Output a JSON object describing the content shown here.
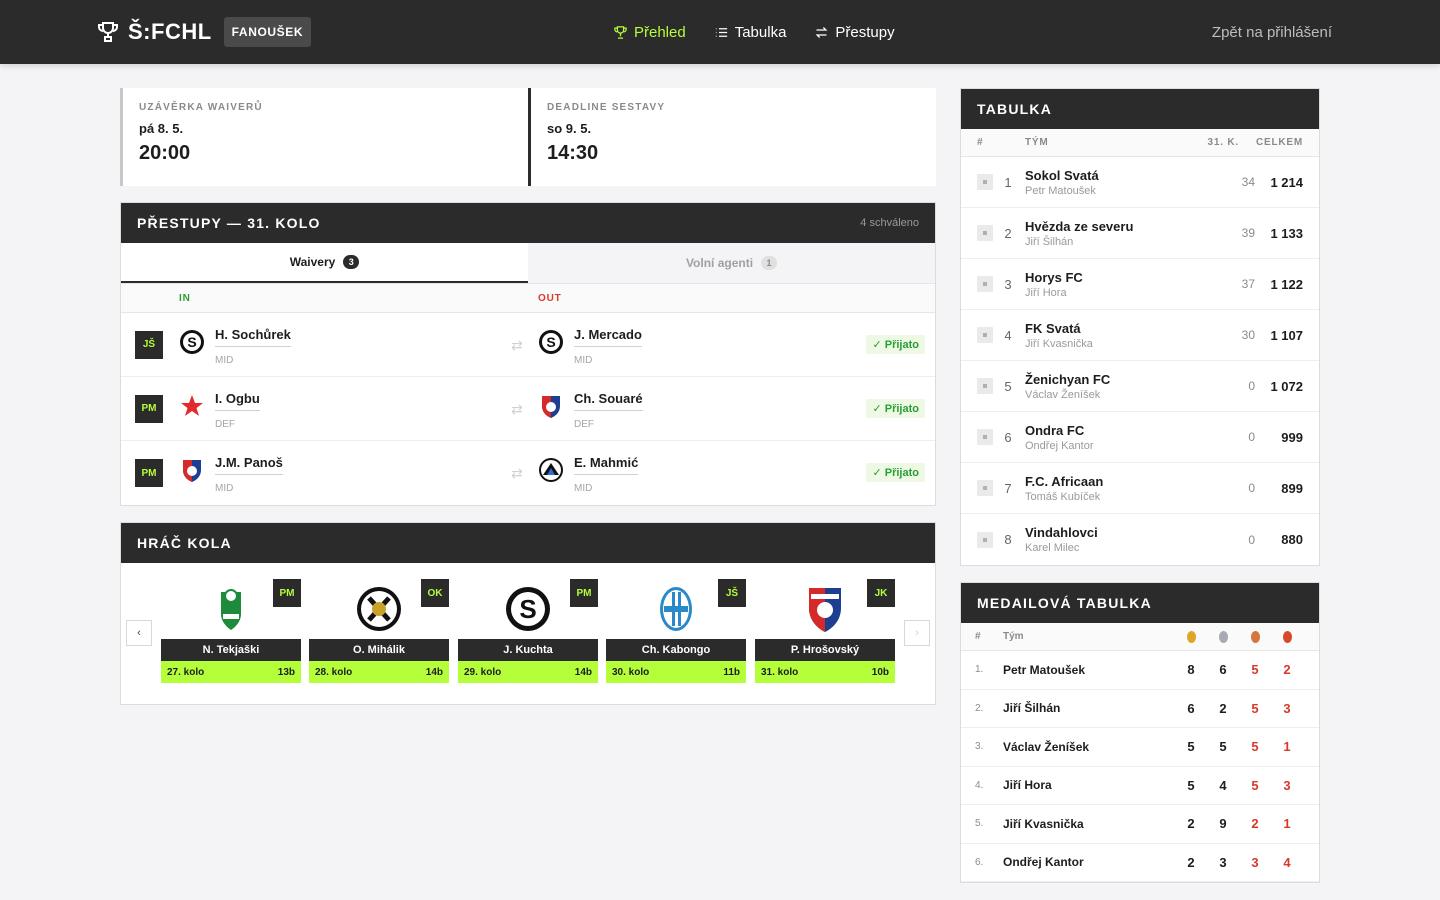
{
  "nav": {
    "brand": "Š:FCHL",
    "role": "FANOUŠEK",
    "items": [
      {
        "label": "Přehled",
        "icon": "trophy-icon",
        "active": true
      },
      {
        "label": "Tabulka",
        "icon": "list-icon",
        "active": false
      },
      {
        "label": "Přestupy",
        "icon": "swap-icon",
        "active": false
      }
    ],
    "logout": "Zpět na přihlášení"
  },
  "deadlines": [
    {
      "label": "UZÁVĚRKA WAIVERŮ",
      "date": "pá 8. 5.",
      "time": "20:00"
    },
    {
      "label": "DEADLINE SESTAVY",
      "date": "so 9. 5.",
      "time": "14:30"
    }
  ],
  "transfers": {
    "title": "PŘESTUPY — 31. KOLO",
    "approved": "4 schváleno",
    "tabs": [
      {
        "label": "Waivery",
        "count": "3"
      },
      {
        "label": "Volní agenti",
        "count": "1"
      }
    ],
    "in_label": "IN",
    "out_label": "OUT",
    "rows": [
      {
        "owner": "JŠ",
        "in_name": "H. Sochůrek",
        "in_pos": "MID",
        "out_name": "J. Mercado",
        "out_pos": "MID",
        "status": "✓ Přijato"
      },
      {
        "owner": "PM",
        "in_name": "I. Ogbu",
        "in_pos": "DEF",
        "out_name": "Ch. Souaré",
        "out_pos": "DEF",
        "status": "✓ Přijato"
      },
      {
        "owner": "PM",
        "in_name": "J.M. Panoš",
        "in_pos": "MID",
        "out_name": "E. Mahmić",
        "out_pos": "MID",
        "status": "✓ Přijato"
      }
    ]
  },
  "potr": {
    "title": "HRÁČ KOLA",
    "cards": [
      {
        "owner": "PM",
        "name": "N. Tekjaški",
        "round": "27. kolo",
        "points": "13b"
      },
      {
        "owner": "OK",
        "name": "O. Mihálik",
        "round": "28. kolo",
        "points": "14b"
      },
      {
        "owner": "PM",
        "name": "J. Kuchta",
        "round": "29. kolo",
        "points": "14b"
      },
      {
        "owner": "JŠ",
        "name": "Ch. Kabongo",
        "round": "30. kolo",
        "points": "11b"
      },
      {
        "owner": "JK",
        "name": "P. Hrošovský",
        "round": "31. kolo",
        "points": "10b"
      }
    ]
  },
  "standings": {
    "title": "TABULKA",
    "headers": {
      "rank": "#",
      "team": "TÝM",
      "round": "31. K.",
      "total": "CELKEM"
    },
    "rows": [
      {
        "rank": "1",
        "team": "Sokol Svatá",
        "owner": "Petr Matoušek",
        "round": "34",
        "total": "1 214"
      },
      {
        "rank": "2",
        "team": "Hvězda ze severu",
        "owner": "Jiří Šilhán",
        "round": "39",
        "total": "1 133"
      },
      {
        "rank": "3",
        "team": "Horys FC",
        "owner": "Jiří Hora",
        "round": "37",
        "total": "1 122"
      },
      {
        "rank": "4",
        "team": "FK Svatá",
        "owner": "Jiří Kvasnička",
        "round": "30",
        "total": "1 107"
      },
      {
        "rank": "5",
        "team": "Ženichyan FC",
        "owner": "Václav Ženíšek",
        "round": "0",
        "total": "1 072"
      },
      {
        "rank": "6",
        "team": "Ondra FC",
        "owner": "Ondřej Kantor",
        "round": "0",
        "total": "999"
      },
      {
        "rank": "7",
        "team": "F.C. Africaan",
        "owner": "Tomáš Kubíček",
        "round": "0",
        "total": "899"
      },
      {
        "rank": "8",
        "team": "Vindahlovci",
        "owner": "Karel Milec",
        "round": "0",
        "total": "880"
      }
    ]
  },
  "medals": {
    "title": "MEDAILOVÁ TABULKA",
    "headers": {
      "rank": "#",
      "name": "Tým"
    },
    "medal_colors": [
      "#e0a526",
      "#a7a9b4",
      "#d6763c",
      "#d64a2a"
    ],
    "rows": [
      {
        "rank": "1.",
        "name": "Petr Matoušek",
        "gold": "8",
        "silver": "6",
        "bronze": "5",
        "other": "2"
      },
      {
        "rank": "2.",
        "name": "Jiří Šilhán",
        "gold": "6",
        "silver": "2",
        "bronze": "5",
        "other": "3"
      },
      {
        "rank": "3.",
        "name": "Václav Ženíšek",
        "gold": "5",
        "silver": "5",
        "bronze": "5",
        "other": "1"
      },
      {
        "rank": "4.",
        "name": "Jiří Hora",
        "gold": "5",
        "silver": "4",
        "bronze": "5",
        "other": "3"
      },
      {
        "rank": "5.",
        "name": "Jiří Kvasnička",
        "gold": "2",
        "silver": "9",
        "bronze": "2",
        "other": "1"
      },
      {
        "rank": "6.",
        "name": "Ondřej Kantor",
        "gold": "2",
        "silver": "3",
        "bronze": "3",
        "other": "4"
      }
    ]
  }
}
